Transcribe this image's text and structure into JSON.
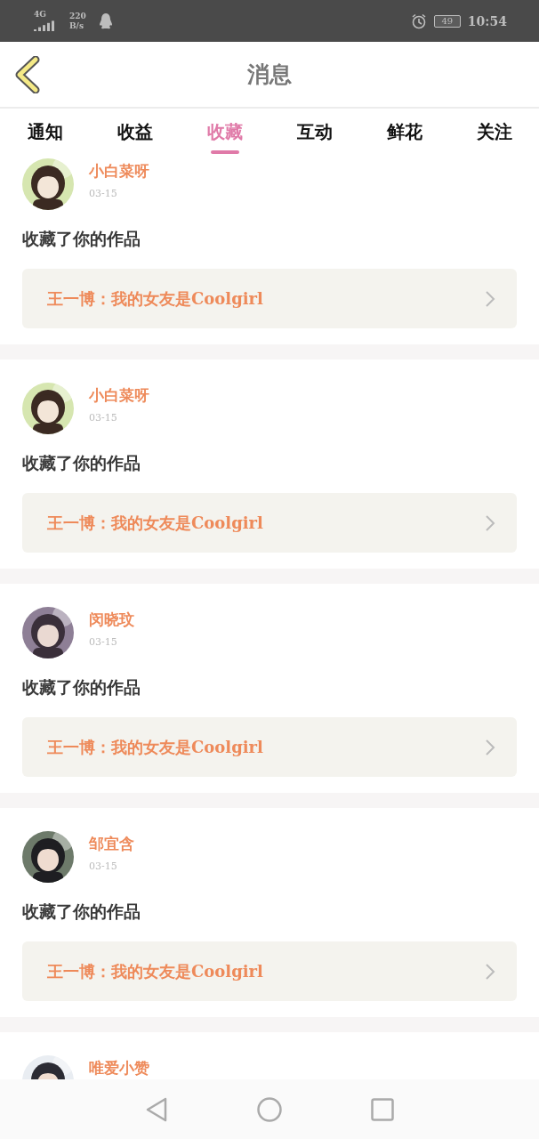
{
  "status_bar": {
    "network": "4G",
    "speed_value": "220",
    "speed_unit": "B/s",
    "battery": "49",
    "time": "10:54"
  },
  "header": {
    "title": "消息"
  },
  "tabs": [
    {
      "label": "通知",
      "selected": false
    },
    {
      "label": "收益",
      "selected": false
    },
    {
      "label": "收藏",
      "selected": true
    },
    {
      "label": "互动",
      "selected": false
    },
    {
      "label": "鲜花",
      "selected": false
    },
    {
      "label": "关注",
      "selected": false
    }
  ],
  "messages": [
    {
      "name": "小白菜呀",
      "date": "03-15",
      "action": "收藏了你的作品",
      "work": "王一博：我的女友是Coolgirl"
    },
    {
      "name": "小白菜呀",
      "date": "03-15",
      "action": "收藏了你的作品",
      "work": "王一博：我的女友是Coolgirl"
    },
    {
      "name": "闵晓玟",
      "date": "03-15",
      "action": "收藏了你的作品",
      "work": "王一博：我的女友是Coolgirl"
    },
    {
      "name": "邹宜含",
      "date": "03-15",
      "action": "收藏了你的作品",
      "work": "王一博：我的女友是Coolgirl"
    },
    {
      "name": "唯爱小赞"
    }
  ]
}
